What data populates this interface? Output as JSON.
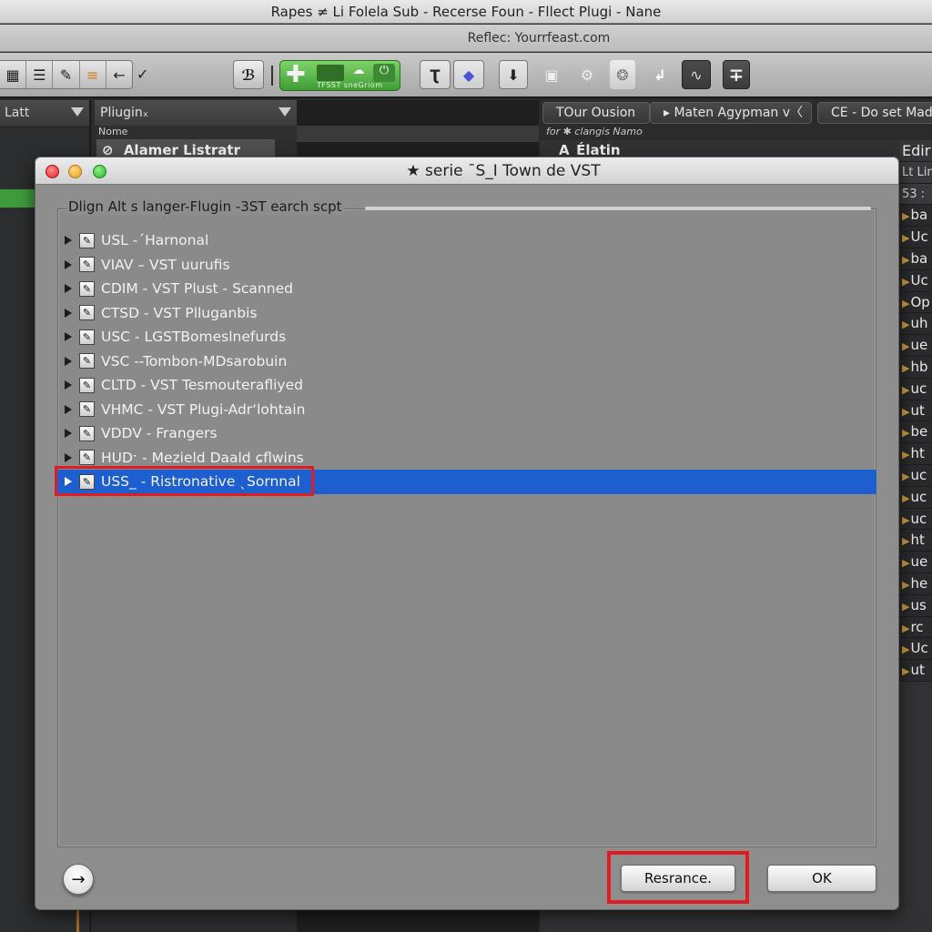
{
  "window": {
    "title": "Rapes ≠ Li Folela Sub - Recerse Foun - Fllect Plugi - Nane",
    "subtitle": "Reflec: Yourrfeast.com"
  },
  "toolbar": {
    "left_group": [
      {
        "name": "grid-icon",
        "glyph": "▦"
      },
      {
        "name": "list-icon",
        "glyph": "☰"
      },
      {
        "name": "pencil-icon",
        "glyph": "✎"
      },
      {
        "name": "mixer-icon",
        "glyph": "≡"
      },
      {
        "name": "back-arrow-icon",
        "glyph": "←"
      }
    ],
    "dropdown_glyph": "✓",
    "script_glyph": "ℬ",
    "green_panel": {
      "plus_glyph": "✚",
      "icon1": "☁",
      "icon2": "⏻",
      "label": "TFSST  sneGriom"
    },
    "right_buttons": [
      {
        "name": "tool-t-icon",
        "glyph": "Ʈ"
      },
      {
        "name": "gem-icon",
        "glyph": "◆"
      },
      {
        "name": "download-icon",
        "glyph": "⬇"
      },
      {
        "name": "folder-icon",
        "glyph": "▣"
      },
      {
        "name": "settings-icon",
        "glyph": "⚙"
      },
      {
        "name": "puzzle-icon",
        "glyph": "❂"
      },
      {
        "name": "share-icon",
        "glyph": "↲"
      },
      {
        "name": "wave-icon",
        "glyph": "∿"
      },
      {
        "name": "split-icon",
        "glyph": "∓"
      }
    ]
  },
  "left_panel": {
    "title": "Latt"
  },
  "plugin_panel": {
    "title": "Pliuginₓ",
    "column": "Nome",
    "item": "Alamer Listratr",
    "item_icon": "⊘"
  },
  "right_panel": {
    "tabs": [
      "TOur Ousion",
      "▸ Maten Agypman v〈",
      "CE - Do set Mad"
    ],
    "subheader": "for ✱ clangis Namo",
    "row1": "A_Élatin",
    "edit_column": {
      "header": "Edir",
      "sub1": "Lt Lin",
      "sub2": "53 :",
      "items": [
        "ba",
        "Uc",
        "ba",
        "Uc",
        "Op",
        "uh",
        "ue",
        "hb",
        "uc",
        "ut",
        "be",
        "ht",
        "uc",
        "uc",
        "uc",
        "ht",
        "ue",
        "he",
        "us",
        "rc",
        "Uc",
        "ut"
      ]
    }
  },
  "dialog": {
    "title": "★ serie ˉS_I Town de VST",
    "group_label": "Dlign Alt s langer-Flugin -3ST earch scpt",
    "plugins": [
      {
        "label": "USL -ˊHarnonal",
        "selected": false
      },
      {
        "label": "VIAV  – VST uurufis",
        "selected": false
      },
      {
        "label": "CDIM - VST Plust - Scanned",
        "selected": false
      },
      {
        "label": "CTSD - VST Plluganbis",
        "selected": false
      },
      {
        "label": "USC - LGSTBomeslnefurds",
        "selected": false
      },
      {
        "label": "VSC --Tombon-MDsarobuin",
        "selected": false
      },
      {
        "label": "CLTD - VST Tesmouterafliyed",
        "selected": false
      },
      {
        "label": "VHMC - VST Plugi-Adr‘lohtain",
        "selected": false
      },
      {
        "label": "VDDV - Frangers",
        "selected": false
      },
      {
        "label": "HUDˑ - Mezield Daald ɕflwins",
        "selected": false
      },
      {
        "label": "USS_ - Ristronative ˎSornnal",
        "selected": true
      }
    ],
    "arrow_button_glyph": "→",
    "buttons": {
      "rescan": "Resrance.",
      "ok": "OK"
    }
  },
  "colors": {
    "selection": "#1d5fcf",
    "highlight_outline": "#e21b23",
    "green_panel": "#4caa3e",
    "dialog_bg": "#8e8e8e"
  }
}
